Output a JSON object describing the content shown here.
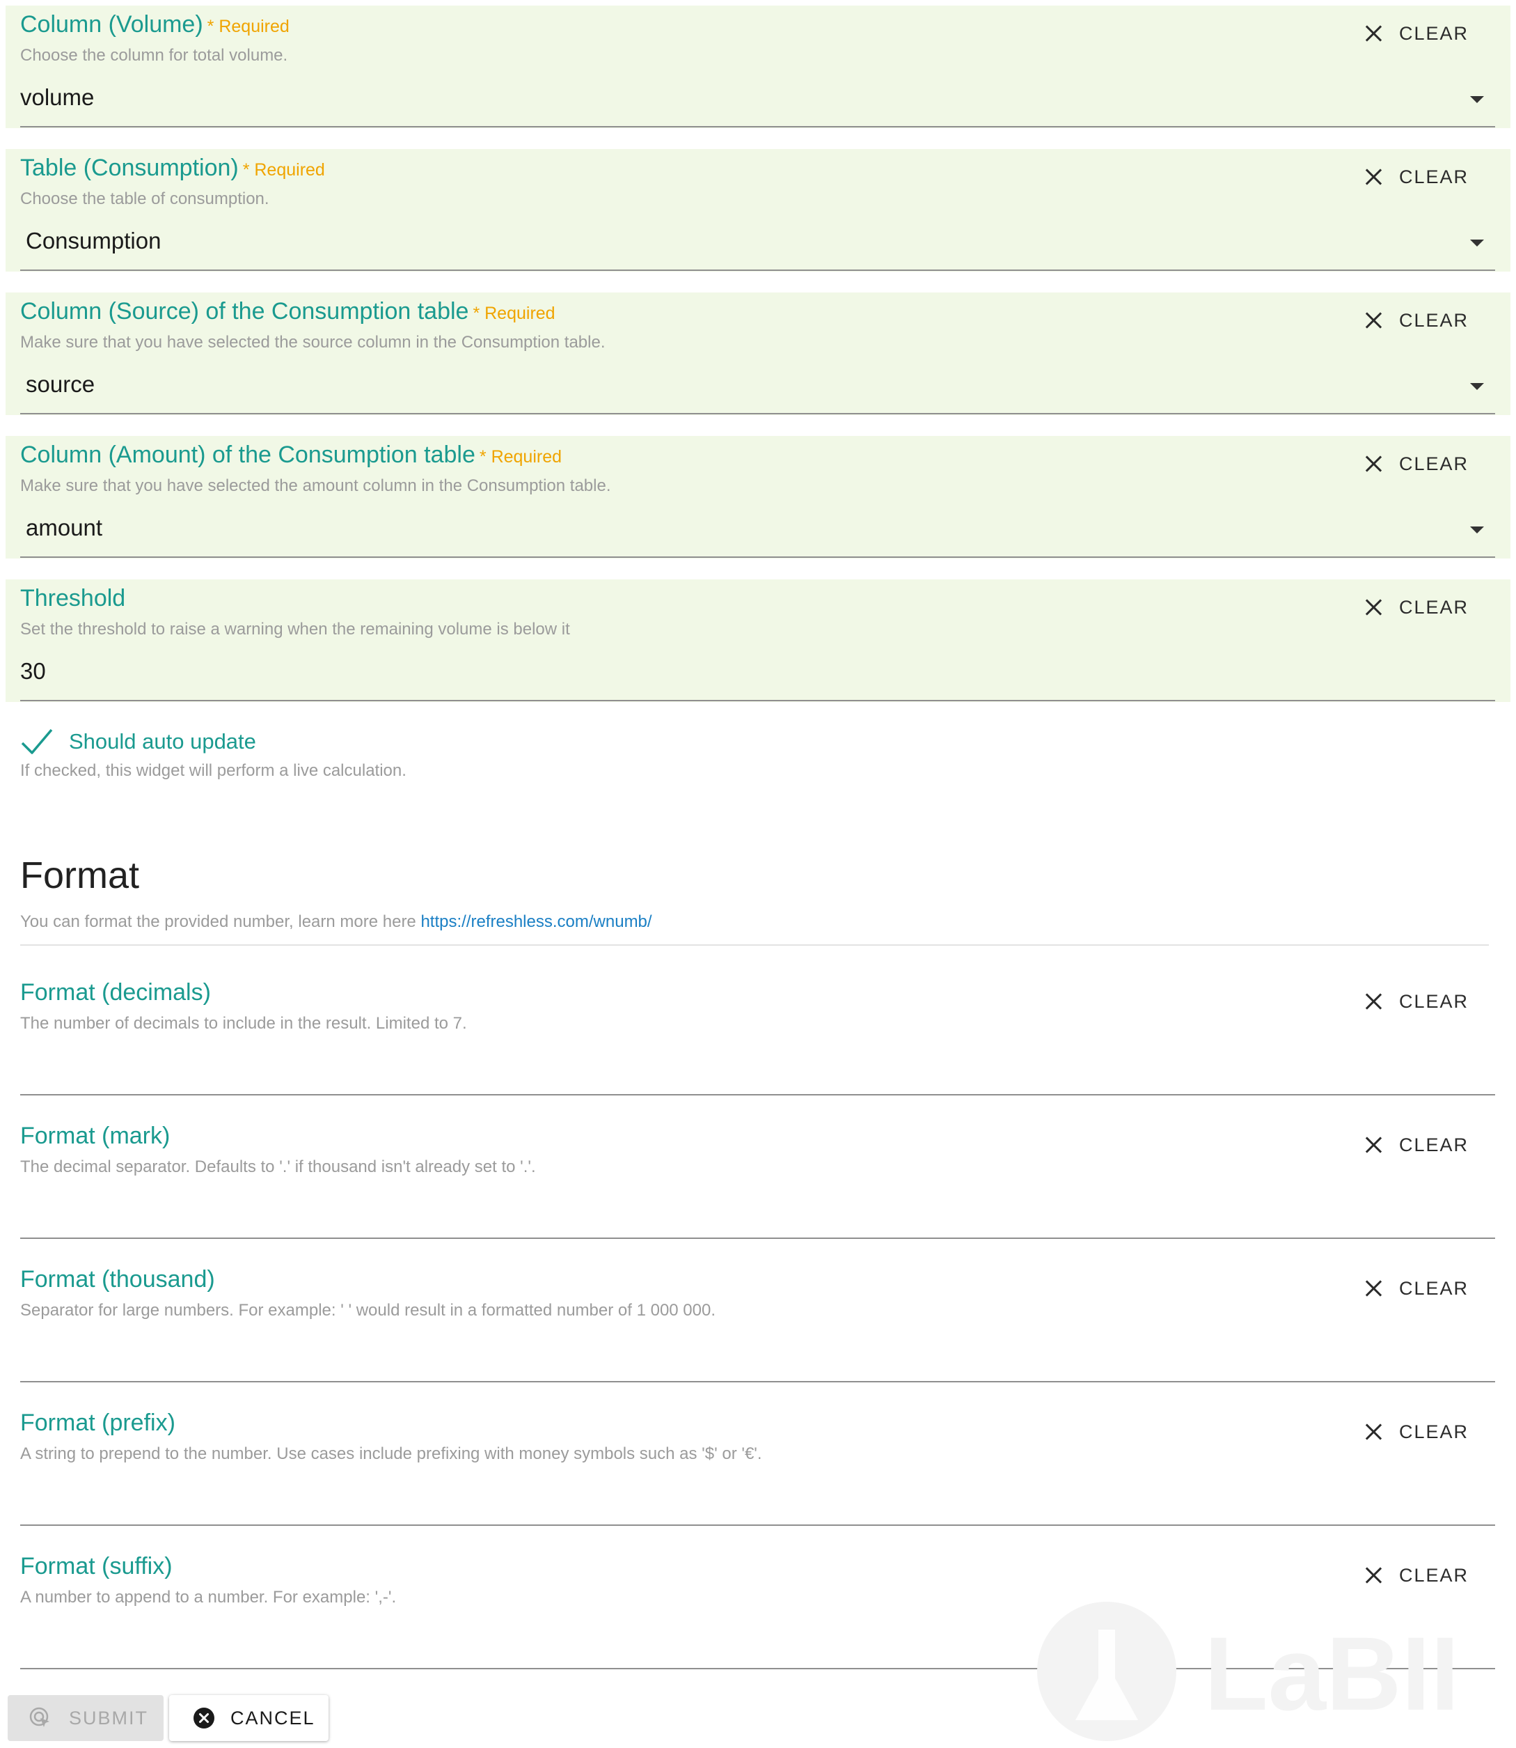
{
  "clear_label": "CLEAR",
  "required_label": "* Required",
  "fields": [
    {
      "label": "Column (Volume)",
      "help": "Choose the column for total volume.",
      "value": "volume"
    },
    {
      "label": "Table (Consumption)",
      "help": "Choose the table of consumption.",
      "value": "Consumption"
    },
    {
      "label": "Column (Source) of the Consumption table",
      "help": "Make sure that you have selected the source column in the Consumption table.",
      "value": "source"
    },
    {
      "label": "Column (Amount) of the Consumption table",
      "help": "Make sure that you have selected the amount column in the Consumption table.",
      "value": "amount"
    },
    {
      "label": "Threshold",
      "help": "Set the threshold to raise a warning when the remaining volume is below it",
      "value": "30"
    }
  ],
  "auto_update": {
    "label": "Should auto update",
    "help": "If checked, this widget will perform a live calculation.",
    "checked": true
  },
  "format_section": {
    "title": "Format",
    "description": "You can format the provided number, learn more here",
    "link_text": "https://refreshless.com/wnumb/"
  },
  "format_fields": [
    {
      "label": "Format (decimals)",
      "help": "The number of decimals to include in the result. Limited to 7.",
      "value": ""
    },
    {
      "label": "Format (mark)",
      "help": "The decimal separator. Defaults to '.' if thousand isn't already set to '.'.",
      "value": ""
    },
    {
      "label": "Format (thousand)",
      "help": "Separator for large numbers. For example: ' ' would result in a formatted number of 1 000 000.",
      "value": ""
    },
    {
      "label": "Format (prefix)",
      "help": "A string to prepend to the number. Use cases include prefixing with money symbols such as '$' or '€'.",
      "value": ""
    },
    {
      "label": "Format (suffix)",
      "help": "A number to append to a number. For example: ',-'.",
      "value": ""
    }
  ],
  "buttons": {
    "submit": "SUBMIT",
    "cancel": "CANCEL"
  },
  "watermark_text": "LaBII",
  "colors": {
    "accent": "#1a9a8f",
    "required": "#f0a400",
    "field_bg": "#f1f8e6",
    "link": "#1a7fc4"
  }
}
